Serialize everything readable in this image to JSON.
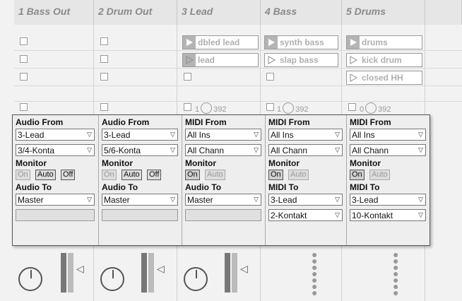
{
  "tracks": [
    {
      "name": "1 Bass Out"
    },
    {
      "name": "2 Drum Out"
    },
    {
      "name": "3 Lead",
      "clips": [
        "dbled lead",
        "lead"
      ],
      "meter": "392",
      "meter_num": "1"
    },
    {
      "name": "4 Bass",
      "clips": [
        "synth bass",
        "slap bass"
      ],
      "meter": "392",
      "meter_num": "1"
    },
    {
      "name": "5 Drums",
      "clips": [
        "drums",
        "kick drum",
        "closed HH"
      ],
      "meter": "392",
      "meter_num": "0"
    }
  ],
  "io": [
    {
      "from_label": "Audio From",
      "from": "3-Lead",
      "chan": "3/4-Konta",
      "monitor_label": "Monitor",
      "mon": [
        "On",
        "Auto",
        "Off"
      ],
      "to_label": "Audio To",
      "to": "Master"
    },
    {
      "from_label": "Audio From",
      "from": "3-Lead",
      "chan": "5/6-Konta",
      "monitor_label": "Monitor",
      "mon": [
        "On",
        "Auto",
        "Off"
      ],
      "to_label": "Audio To",
      "to": "Master"
    },
    {
      "from_label": "MIDI From",
      "from": "All Ins",
      "chan": "All Chann",
      "monitor_label": "Monitor",
      "mon": [
        "On",
        "Auto"
      ],
      "to_label": "Audio To",
      "to": "Master"
    },
    {
      "from_label": "MIDI From",
      "from": "All Ins",
      "chan": "All Chann",
      "monitor_label": "Monitor",
      "mon": [
        "On",
        "Auto"
      ],
      "to_label": "MIDI To",
      "to": "3-Lead",
      "to2": "2-Kontakt"
    },
    {
      "from_label": "MIDI From",
      "from": "All Ins",
      "chan": "All Chann",
      "monitor_label": "Monitor",
      "mon": [
        "On",
        "Auto"
      ],
      "to_label": "MIDI To",
      "to": "3-Lead",
      "to2": "10-Kontakt"
    }
  ],
  "icons": {
    "play": "play-triangle-icon",
    "dropdown": "dropdown-arrow-icon"
  }
}
